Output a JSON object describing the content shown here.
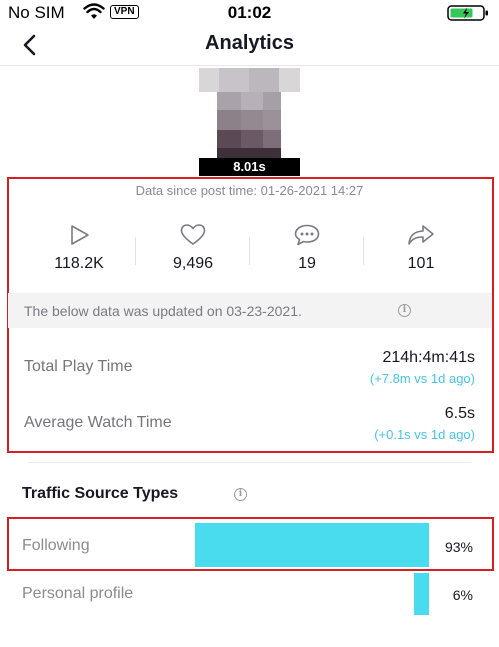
{
  "status_bar": {
    "carrier": "No SIM",
    "vpn": "VPN",
    "time": "01:02"
  },
  "nav": {
    "title": "Analytics"
  },
  "video": {
    "duration": "8.01s"
  },
  "overview": {
    "since_text": "Data since post time: 01-26-2021 14:27",
    "stats": [
      {
        "icon": "play-icon",
        "value": "118.2K"
      },
      {
        "icon": "heart-icon",
        "value": "9,496"
      },
      {
        "icon": "comment-icon",
        "value": "19"
      },
      {
        "icon": "share-icon",
        "value": "101"
      }
    ]
  },
  "update_notice": {
    "text": "The below data was updated on 03-23-2021."
  },
  "metrics": [
    {
      "label": "Total Play Time",
      "value": "214h:4m:41s",
      "delta": "(+7.8m vs 1d ago)"
    },
    {
      "label": "Average Watch Time",
      "value": "6.5s",
      "delta": "(+0.1s vs 1d ago)"
    }
  ],
  "traffic": {
    "title": "Traffic Source Types",
    "accent_color": "#49dcef",
    "sources": [
      {
        "label": "Following",
        "pct_text": "93%",
        "fraction": 0.93
      },
      {
        "label": "Personal profile",
        "pct_text": "6%",
        "fraction": 0.06
      }
    ]
  }
}
